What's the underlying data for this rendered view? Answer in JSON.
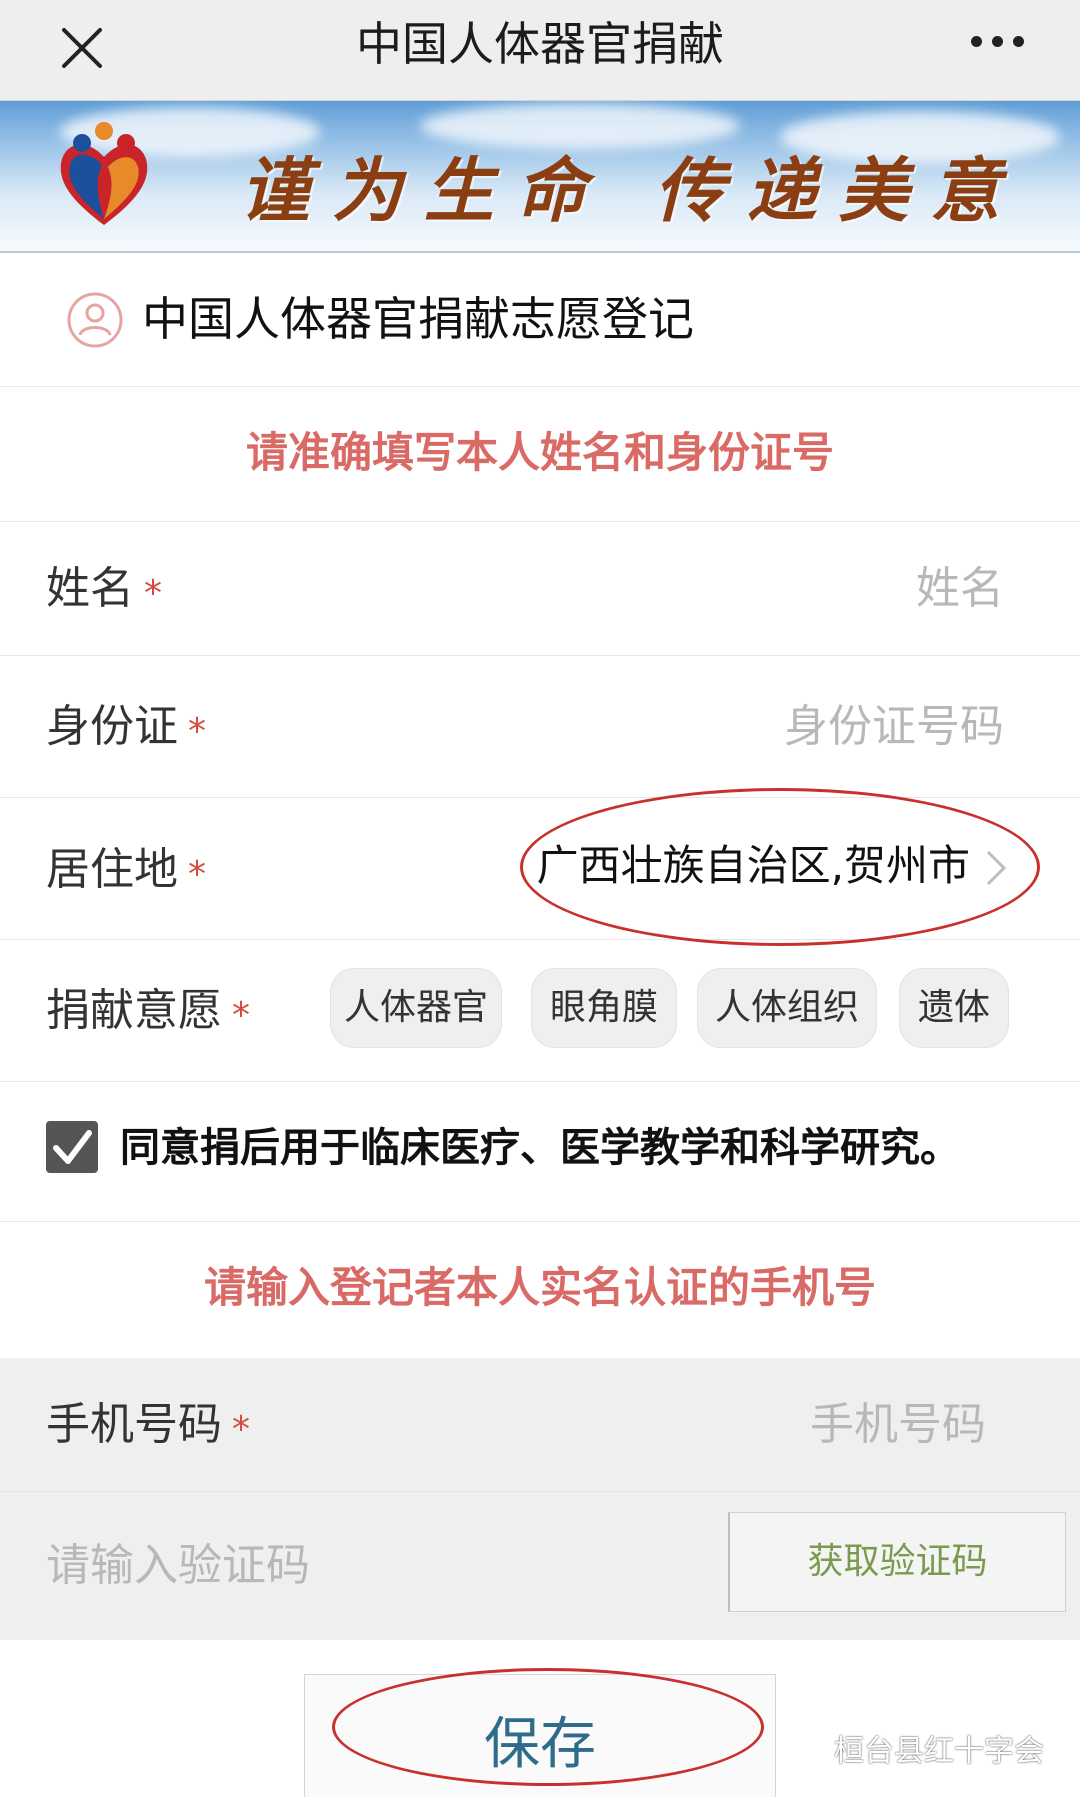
{
  "topbar": {
    "title": "中国人体器官捐献"
  },
  "banner": {
    "slogan": "谨为生命  传递美意"
  },
  "section": {
    "title": "中国人体器官捐献志愿登记"
  },
  "notice_identity": "请准确填写本人姓名和身份证号",
  "form": {
    "name": {
      "label": "姓名",
      "required_mark": "*",
      "placeholder": "姓名"
    },
    "id_card": {
      "label": "身份证",
      "required_mark": "*",
      "placeholder": "身份证号码"
    },
    "residence": {
      "label": "居住地",
      "required_mark": "*",
      "value": "广西壮族自治区,贺州市"
    },
    "intent": {
      "label": "捐献意愿",
      "required_mark": "*",
      "options": [
        "人体器官",
        "眼角膜",
        "人体组织",
        "遗体"
      ]
    },
    "agree": {
      "checked": true,
      "text": "同意捐后用于临床医疗、医学教学和科学研究。"
    }
  },
  "notice_phone": "请输入登记者本人实名认证的手机号",
  "phone": {
    "label": "手机号码",
    "required_mark": "*",
    "placeholder": "手机号码"
  },
  "verify": {
    "placeholder": "请输入验证码",
    "button_label": "获取验证码"
  },
  "save_label": "保存",
  "watermark": "桓台县红十字会",
  "colors": {
    "notice_red": "#d96a66",
    "required_red": "#d64b3f",
    "annotation_oval": "#c9302c",
    "code_button_text": "#7a9a4e",
    "save_text": "#2d6c8a"
  }
}
